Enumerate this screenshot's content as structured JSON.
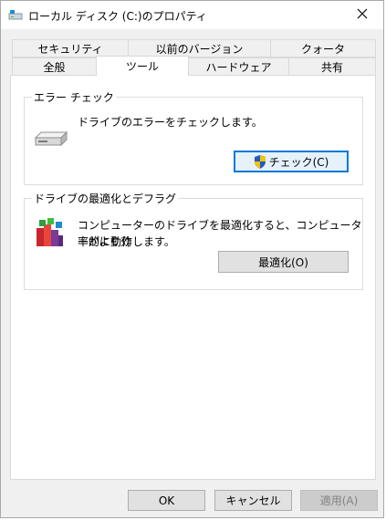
{
  "window": {
    "title": "ローカル ディスク (C:)のプロパティ"
  },
  "tabs": {
    "row1": [
      "セキュリティ",
      "以前のバージョン",
      "クォータ"
    ],
    "row2": [
      "全般",
      "ツール",
      "ハードウェア",
      "共有"
    ],
    "active": "ツール"
  },
  "error_check": {
    "title": "エラー チェック",
    "description": "ドライブのエラーをチェックします。",
    "button_label": "チェック(C)"
  },
  "optimize": {
    "title": "ドライブの最適化とデフラグ",
    "description_line1": "コンピューターのドライブを最適化すると、コンピューターがより効",
    "description_line2": "率的に動作します。",
    "button_label": "最適化(O)"
  },
  "footer": {
    "ok_label": "OK",
    "cancel_label": "キャンセル",
    "apply_label": "適用(A)"
  },
  "colors": {
    "focus_border": "#0078d7",
    "shield_blue": "#1e5bc6",
    "shield_yellow": "#f2c200"
  }
}
